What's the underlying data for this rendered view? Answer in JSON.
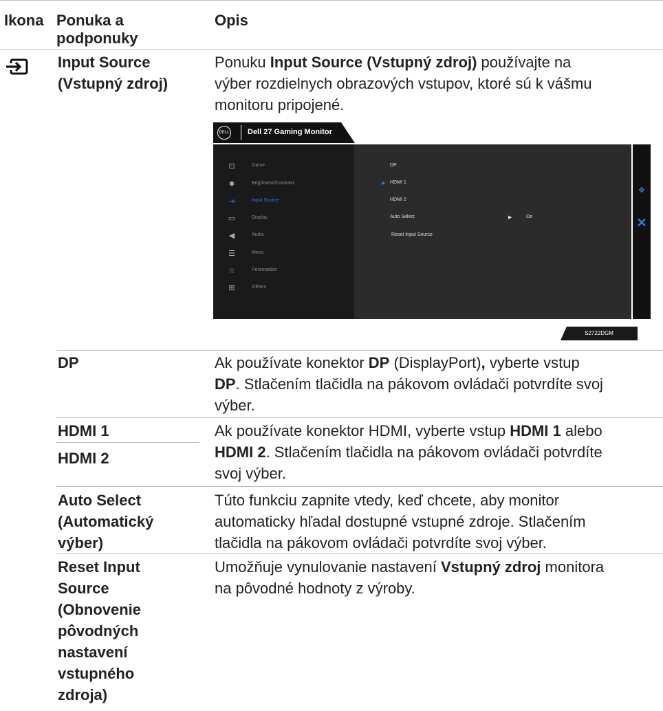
{
  "header": {
    "col_icon": "Ikona",
    "col_menu_line1": "Ponuka a",
    "col_menu_line2": "podponuky",
    "col_desc": "Opis"
  },
  "input_source": {
    "name_line1": "Input Source",
    "name_line2": "(Vstupný zdroj)",
    "desc_l1_pre": "Ponuku ",
    "desc_l1_bold": "Input Source (Vstupný zdroj)",
    "desc_l1_post": " používajte na",
    "desc_l2": "výber rozdielnych obrazových vstupov, ktoré sú k vášmu",
    "desc_l3": "monitoru pripojené."
  },
  "osd": {
    "logo": "DELL",
    "title": "Dell 27 Gaming Monitor",
    "menu": [
      {
        "icon": "game-icon",
        "glyph": "⊡",
        "label": "Game"
      },
      {
        "icon": "brightness-icon",
        "glyph": "✹",
        "label": "Brightness/Contrast"
      },
      {
        "icon": "input-source-icon",
        "glyph": "⇥",
        "label": "Input Source"
      },
      {
        "icon": "display-icon",
        "glyph": "▭",
        "label": "Display"
      },
      {
        "icon": "audio-icon",
        "glyph": "◀",
        "label": "Audio"
      },
      {
        "icon": "menu-icon",
        "glyph": "☰",
        "label": "Menu"
      },
      {
        "icon": "star-icon",
        "glyph": "☆",
        "label": "Personalize"
      },
      {
        "icon": "others-icon",
        "glyph": "⊞",
        "label": "Others"
      }
    ],
    "sub": [
      "DP",
      "HDMI 1",
      "HDMI 2",
      "Auto Select",
      "Reset Input Source"
    ],
    "auto_select_value": "On",
    "active_color": "#2e7fe0",
    "model": "S2722DGM"
  },
  "rows": {
    "dp": {
      "name": "DP",
      "l1_pre": "Ak používate konektor ",
      "l1_b1": "DP",
      "l1_mid": " (DisplayPort)",
      "l1_b2": ",",
      "l1_post": " vyberte vstup",
      "l2_b": "DP",
      "l2_post": ". Stlačením tlačidla na pákovom ovládači potvrdíte svoj",
      "l3": "výber."
    },
    "hdmi": {
      "name1": "HDMI 1",
      "name2": "HDMI 2",
      "l1_pre": "Ak používate konektor HDMI, vyberte vstup ",
      "l1_b": "HDMI 1",
      "l1_post": " alebo",
      "l2_b": "HDMI 2",
      "l2_post": ". Stlačením tlačidla na pákovom ovládači potvrdíte",
      "l3": "svoj výber."
    },
    "auto": {
      "name1": "Auto Select",
      "name2": "(Automatický",
      "name3": "výber)",
      "l1": "Túto funkciu zapnite vtedy, keď chcete, aby monitor",
      "l2": "automaticky hľadal dostupné vstupné zdroje. Stlačením",
      "l3": "tlačidla na pákovom ovládači potvrdíte svoj výber."
    },
    "reset": {
      "name1": "Reset Input",
      "name2": "Source",
      "name3": "(Obnovenie",
      "name4": "pôvodných",
      "name5": "nastavení",
      "name6": "vstupného",
      "name7": "zdroja)",
      "l1_pre": "Umožňuje vynulovanie nastavení ",
      "l1_b": "Vstupný zdroj",
      "l1_post": " monitora",
      "l2": "na pôvodné hodnoty z výroby."
    }
  }
}
